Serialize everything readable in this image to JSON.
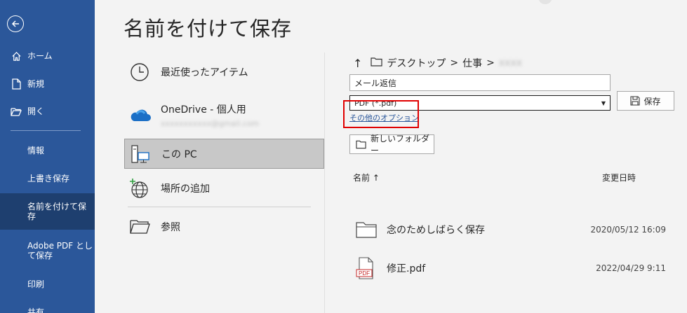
{
  "sidebar": {
    "items": [
      {
        "label": "ホーム",
        "icon": "home-icon"
      },
      {
        "label": "新規",
        "icon": "new-document-icon"
      },
      {
        "label": "開く",
        "icon": "open-folder-icon"
      },
      {
        "label": "情報"
      },
      {
        "label": "上書き保存"
      },
      {
        "label": "名前を付けて保\n存",
        "active": true
      },
      {
        "label": "Adobe PDF とし\nて保存"
      },
      {
        "label": "印刷"
      },
      {
        "label": "共有"
      }
    ]
  },
  "title": "名前を付けて保存",
  "locations": {
    "recent": "最近使ったアイテム",
    "onedrive": "OneDrive - 個人用",
    "onedrive_sub": "xxxxxxxxxxx@gmail.com",
    "thispc": "この PC",
    "addplace": "場所の追加",
    "browse": "参照"
  },
  "breadcrumb": {
    "parts": [
      "デスクトップ",
      "仕事"
    ],
    "blurred": "xxxx",
    "separator": ">"
  },
  "filename": {
    "value": "メール返信"
  },
  "filetype": {
    "value": "PDF (*.pdf)"
  },
  "more_options": "その他のオプション",
  "save_button": "保存",
  "new_folder": "新しいフォルダー",
  "list": {
    "col_name": "名前 ↑",
    "col_modified": "変更日時",
    "rows": [
      {
        "name": "念のためしばらく保存",
        "modified": "2020/05/12 16:09",
        "icon": "folder-icon"
      },
      {
        "name": "修正.pdf",
        "modified": "2022/04/29 9:11",
        "icon": "pdf-file-icon"
      }
    ]
  },
  "colors": {
    "sidebar": "#2b579a",
    "sidebar_active": "#1e3f6f",
    "highlight": "#e00000"
  }
}
